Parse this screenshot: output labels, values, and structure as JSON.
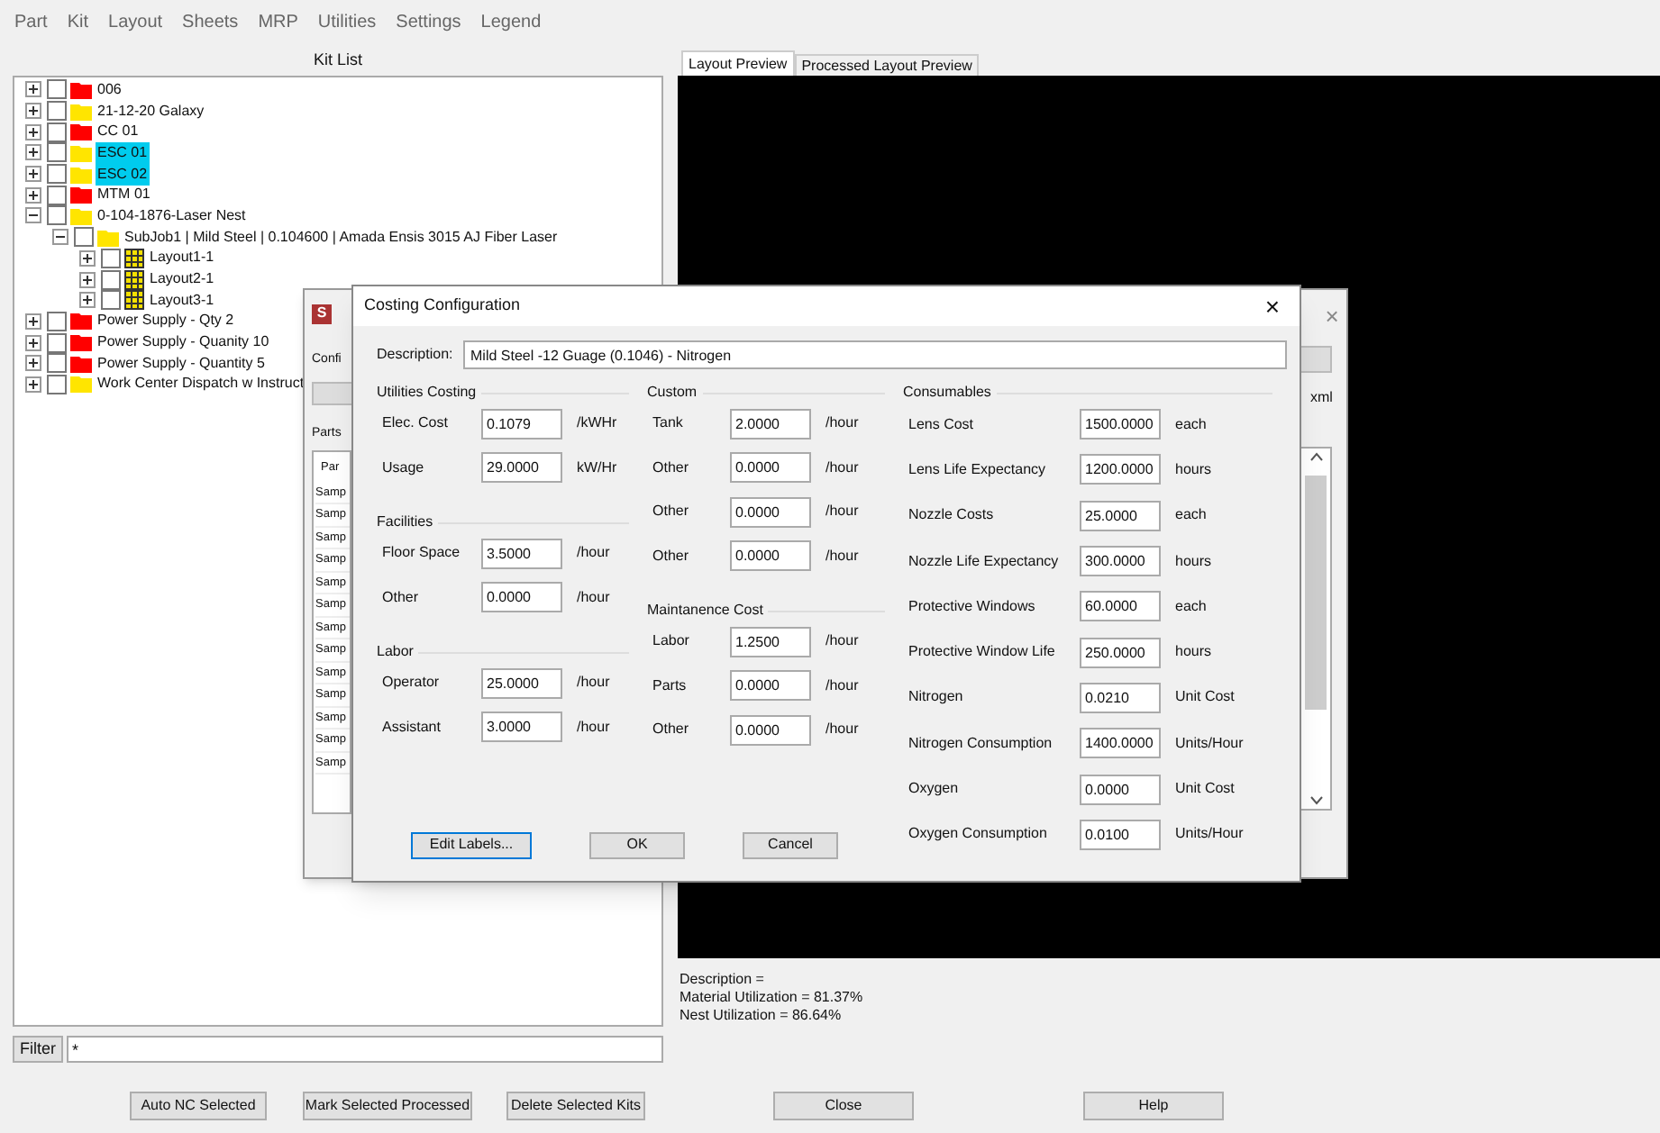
{
  "menu": [
    "Part",
    "Kit",
    "Layout",
    "Sheets",
    "MRP",
    "Utilities",
    "Settings",
    "Legend"
  ],
  "kit_list": {
    "title": "Kit List",
    "items": [
      {
        "label": "006",
        "kind": "folder",
        "color": "#ff0000",
        "checked": false,
        "selected": false,
        "expanded": false
      },
      {
        "label": "21-12-20 Galaxy",
        "kind": "folder",
        "color": "#ffe500",
        "checked": false,
        "selected": false,
        "expanded": false
      },
      {
        "label": "CC 01",
        "kind": "folder",
        "color": "#ff0000",
        "checked": false,
        "selected": false,
        "expanded": false
      },
      {
        "label": "ESC 01",
        "kind": "folder",
        "color": "#ffe500",
        "checked": false,
        "selected": true,
        "expanded": false
      },
      {
        "label": "ESC 02",
        "kind": "folder",
        "color": "#ffe500",
        "checked": false,
        "selected": true,
        "expanded": false
      },
      {
        "label": "MTM 01",
        "kind": "folder",
        "color": "#ff0000",
        "checked": false,
        "selected": false,
        "expanded": false
      },
      {
        "label": "0-104-1876-Laser Nest",
        "kind": "folder",
        "color": "#ffe500",
        "checked": false,
        "selected": false,
        "expanded": true,
        "children": [
          {
            "label": "SubJob1 | Mild Steel | 0.104600 | Amada Ensis 3015 AJ Fiber Laser",
            "kind": "folder",
            "color": "#ffe500",
            "checked": false,
            "selected": false,
            "expanded": true,
            "children": [
              {
                "label": "Layout1-1",
                "kind": "layout",
                "checked": false,
                "selected": false,
                "expanded": false
              },
              {
                "label": "Layout2-1",
                "kind": "layout",
                "checked": false,
                "selected": false,
                "expanded": false
              },
              {
                "label": "Layout3-1",
                "kind": "layout",
                "checked": false,
                "selected": false,
                "expanded": false
              }
            ]
          }
        ]
      },
      {
        "label": "Power Supply - Qty 2",
        "kind": "folder",
        "color": "#ff0000",
        "checked": false,
        "selected": false,
        "expanded": false
      },
      {
        "label": "Power Supply - Quanity 10",
        "kind": "folder",
        "color": "#ff0000",
        "checked": false,
        "selected": false,
        "expanded": false
      },
      {
        "label": "Power Supply - Quantity 5",
        "kind": "folder",
        "color": "#ff0000",
        "checked": false,
        "selected": false,
        "expanded": false
      },
      {
        "label": "Work Center Dispatch w Instruct",
        "kind": "folder",
        "color": "#ffe500",
        "checked": false,
        "selected": false,
        "expanded": false
      }
    ]
  },
  "filter": {
    "label": "Filter",
    "value": "*"
  },
  "preview": {
    "tabs": [
      {
        "label": "Layout Preview",
        "selected": true
      },
      {
        "label": "Processed Layout Preview",
        "selected": false
      }
    ],
    "info": [
      "Description =",
      "Material Utilization = 81.37%",
      "Nest Utilization = 86.64%"
    ]
  },
  "buttons": [
    "Auto NC Selected",
    "Mark Selected Processed",
    "Delete Selected Kits",
    "Close",
    "Help"
  ],
  "back_window": {
    "title": "S",
    "config_label": "Confi",
    "parts_label": "Parts",
    "list_header": "Par",
    "rows": [
      "Samp",
      "Samp",
      "Samp",
      "Samp",
      "Samp",
      "Samp",
      "Samp",
      "Samp",
      "Samp",
      "Samp",
      "Samp",
      "Samp",
      "Samp"
    ],
    "right_label": "xml",
    "close": "×"
  },
  "dialog": {
    "title": "Costing Configuration",
    "close": "×",
    "description": {
      "label": "Description:",
      "value": "Mild Steel -12 Guage (0.1046) - Nitrogen"
    },
    "columns": [
      [
        {
          "title": "Utilities Costing",
          "rows": [
            {
              "label": "Elec. Cost",
              "value": "0.1079",
              "unit": "/kWHr"
            },
            {
              "label": "Usage",
              "value": "29.0000",
              "unit": "kW/Hr"
            }
          ]
        },
        {
          "title": "Facilities",
          "rows": [
            {
              "label": "Floor Space",
              "value": "3.5000",
              "unit": "/hour"
            },
            {
              "label": "Other",
              "value": "0.0000",
              "unit": "/hour"
            }
          ]
        },
        {
          "title": "Labor",
          "rows": [
            {
              "label": "Operator",
              "value": "25.0000",
              "unit": "/hour"
            },
            {
              "label": "Assistant",
              "value": "3.0000",
              "unit": "/hour"
            }
          ]
        }
      ],
      [
        {
          "title": "Custom",
          "rows": [
            {
              "label": "Tank",
              "value": "2.0000",
              "unit": "/hour"
            },
            {
              "label": "Other",
              "value": "0.0000",
              "unit": "/hour"
            },
            {
              "label": "Other",
              "value": "0.0000",
              "unit": "/hour"
            },
            {
              "label": "Other",
              "value": "0.0000",
              "unit": "/hour"
            }
          ]
        },
        {
          "title": "Maintanence Cost",
          "rows": [
            {
              "label": "Labor",
              "value": "1.2500",
              "unit": "/hour"
            },
            {
              "label": "Parts",
              "value": "0.0000",
              "unit": "/hour"
            },
            {
              "label": "Other",
              "value": "0.0000",
              "unit": "/hour"
            }
          ]
        }
      ],
      [
        {
          "title": "Consumables",
          "rows": [
            {
              "label": "Lens Cost",
              "value": "1500.0000",
              "unit": "each"
            },
            {
              "label": "Lens Life Expectancy",
              "value": "1200.0000",
              "unit": "hours"
            },
            {
              "label": "Nozzle Costs",
              "value": "25.0000",
              "unit": "each"
            },
            {
              "label": "Nozzle Life Expectancy",
              "value": "300.0000",
              "unit": "hours"
            },
            {
              "label": "Protective Windows",
              "value": "60.0000",
              "unit": "each"
            },
            {
              "label": "Protective Window Life",
              "value": "250.0000",
              "unit": "hours"
            },
            {
              "label": "Nitrogen",
              "value": "0.0210",
              "unit": "Unit Cost"
            },
            {
              "label": "Nitrogen Consumption",
              "value": "1400.0000",
              "unit": "Units/Hour"
            },
            {
              "label": "Oxygen",
              "value": "0.0000",
              "unit": "Unit Cost"
            },
            {
              "label": "Oxygen Consumption",
              "value": "0.0100",
              "unit": "Units/Hour"
            }
          ]
        }
      ]
    ],
    "buttons": [
      {
        "label": "Edit Labels...",
        "focused": true
      },
      {
        "label": "OK",
        "focused": false
      },
      {
        "label": "Cancel",
        "focused": false
      }
    ]
  }
}
